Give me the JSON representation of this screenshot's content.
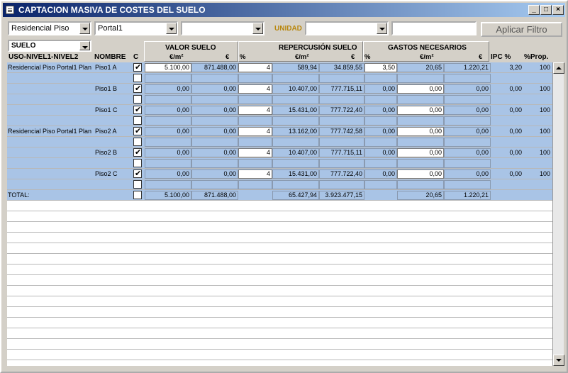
{
  "window": {
    "title": "CAPTACION MASIVA DE COSTES DEL SUELO"
  },
  "filters": {
    "uso": "Residencial Piso",
    "portal": "Portal1",
    "nivel3": "",
    "unidad_label": "UNIDAD",
    "unidad": "",
    "search_text": "",
    "apply_label": "Aplicar Filtro"
  },
  "tipo": "SUELO",
  "headers": {
    "uso_nivel": "USO-NIVEL1-NIVEL2",
    "nombre": "NOMBRE",
    "c": "C",
    "valor_suelo": "VALOR SUELO",
    "repercusion_suelo": "REPERCUSIÓN SUELO",
    "gastos_necesarios": "GASTOS NECESARIOS",
    "eur_m2": "€/m²",
    "eur": "€",
    "pct": "%",
    "ipc": "IPC %",
    "prop": "%Prop."
  },
  "rows": [
    {
      "group": "Residencial Piso Portal1 Plan",
      "name": "Piso1 A",
      "checked": true,
      "vs_m2": "5.100,00",
      "vs_eur": "871.488,00",
      "rep_pct": "4",
      "rep_m2": "589,94",
      "rep_eur": "34.859,55",
      "g_pct": "3,50",
      "g_m2": "20,65",
      "g_eur": "1.220,21",
      "ipc": "3,20",
      "prop": "100"
    },
    {
      "group": "",
      "name": "Piso1 B",
      "checked": true,
      "vs_m2": "0,00",
      "vs_eur": "0,00",
      "rep_pct": "4",
      "rep_m2": "10.407,00",
      "rep_eur": "777.715,11",
      "g_pct": "0,00",
      "g_m2": "0,00",
      "g_eur": "0,00",
      "ipc": "0,00",
      "prop": "100"
    },
    {
      "group": "",
      "name": "Piso1 C",
      "checked": true,
      "vs_m2": "0,00",
      "vs_eur": "0,00",
      "rep_pct": "4",
      "rep_m2": "15.431,00",
      "rep_eur": "777.722,40",
      "g_pct": "0,00",
      "g_m2": "0,00",
      "g_eur": "0,00",
      "ipc": "0,00",
      "prop": "100"
    },
    {
      "group": "Residencial Piso Portal1 Plan",
      "name": "Piso2 A",
      "checked": true,
      "vs_m2": "0,00",
      "vs_eur": "0,00",
      "rep_pct": "4",
      "rep_m2": "13.162,00",
      "rep_eur": "777.742,58",
      "g_pct": "0,00",
      "g_m2": "0,00",
      "g_eur": "0,00",
      "ipc": "0,00",
      "prop": "100"
    },
    {
      "group": "",
      "name": "Piso2 B",
      "checked": true,
      "vs_m2": "0,00",
      "vs_eur": "0,00",
      "rep_pct": "4",
      "rep_m2": "10.407,00",
      "rep_eur": "777.715,11",
      "g_pct": "0,00",
      "g_m2": "0,00",
      "g_eur": "0,00",
      "ipc": "0,00",
      "prop": "100"
    },
    {
      "group": "",
      "name": "Piso2 C",
      "checked": true,
      "vs_m2": "0,00",
      "vs_eur": "0,00",
      "rep_pct": "4",
      "rep_m2": "15.431,00",
      "rep_eur": "777.722,40",
      "g_pct": "0,00",
      "g_m2": "0,00",
      "g_eur": "0,00",
      "ipc": "0,00",
      "prop": "100"
    }
  ],
  "total": {
    "label": "TOTAL:",
    "vs_m2": "5.100,00",
    "vs_eur": "871.488,00",
    "rep_m2": "65.427,94",
    "rep_eur": "3.923.477,15",
    "g_m2": "20,65",
    "g_eur": "1.220,21"
  },
  "colors": {
    "title_start": "#0a246a",
    "title_end": "#a6caf0",
    "row_blue": "#a9c4e6",
    "unidad_label": "#b8860b"
  }
}
